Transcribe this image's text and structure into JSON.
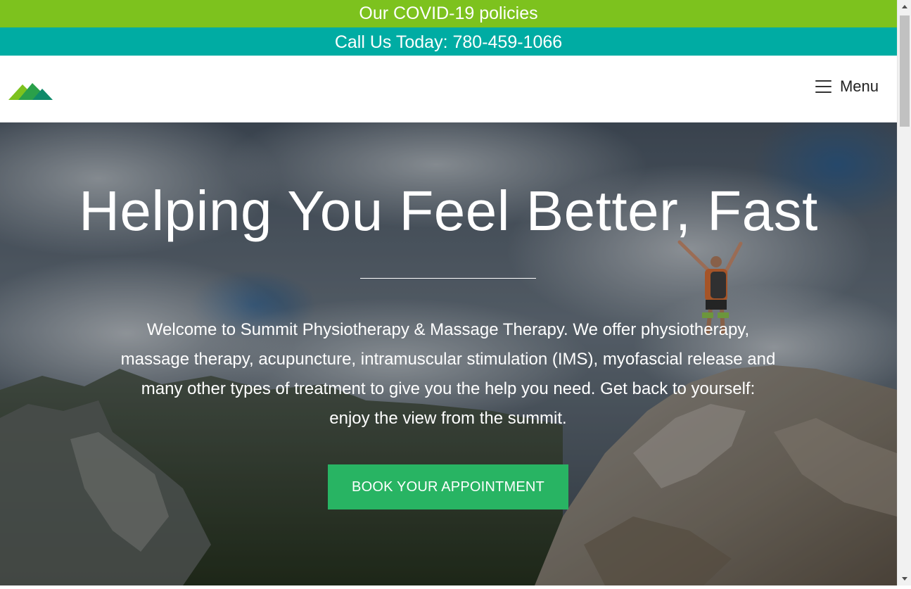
{
  "top_bars": {
    "covid_link": "Our COVID-19 policies",
    "call_text": "Call Us Today: 780-459-1066"
  },
  "header": {
    "logo_icon": "mountain-logo-icon",
    "menu_icon": "hamburger-icon",
    "menu_label": "Menu"
  },
  "hero": {
    "title": "Helping You Feel Better, Fast",
    "text": "Welcome to Summit Physiotherapy & Massage Therapy. We offer physiotherapy, massage therapy, acupuncture, intramuscular stimulation (IMS), myofascial release and many other types of treatment to give you the help you need. Get back to yourself: enjoy the view from the summit.",
    "cta_label": "BOOK YOUR APPOINTMENT"
  },
  "colors": {
    "covid_bar": "#7dc21e",
    "call_bar": "#00aca3",
    "cta": "#28b463"
  }
}
